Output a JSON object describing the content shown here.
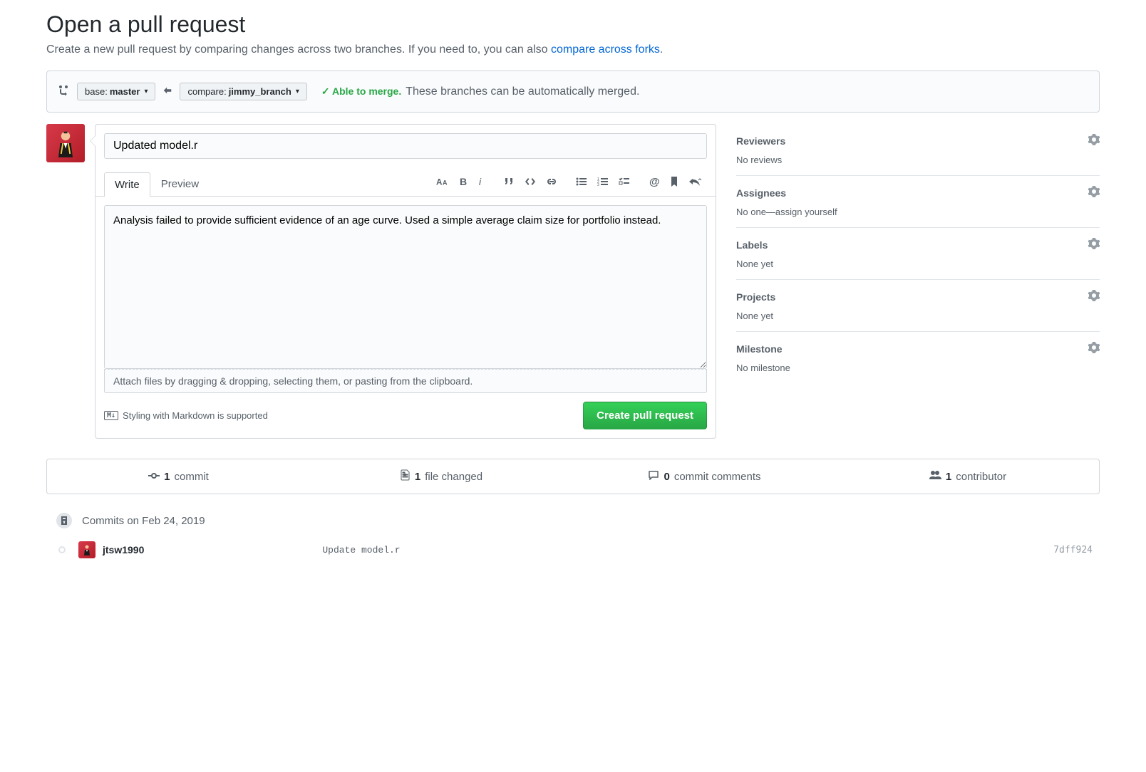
{
  "heading": "Open a pull request",
  "subheading_prefix": "Create a new pull request by comparing changes across two branches. If you need to, you can also ",
  "subheading_link": "compare across forks",
  "subheading_suffix": ".",
  "compare": {
    "base_label": "base: ",
    "base_value": "master",
    "compare_label": "compare: ",
    "compare_value": "jimmy_branch"
  },
  "merge_status": {
    "able": "Able to merge.",
    "detail": "These branches can be automatically merged."
  },
  "form": {
    "title_value": "Updated model.r",
    "tabs": {
      "write": "Write",
      "preview": "Preview"
    },
    "body_value": "Analysis failed to provide sufficient evidence of an age curve. Used a simple average claim size for portfolio instead.",
    "attach_hint": "Attach files by dragging & dropping, selecting them, or pasting from the clipboard.",
    "md_badge": "M↓",
    "md_hint": "Styling with Markdown is supported",
    "submit": "Create pull request"
  },
  "sidebar": {
    "reviewers": {
      "title": "Reviewers",
      "value": "No reviews"
    },
    "assignees": {
      "title": "Assignees",
      "value_prefix": "No one—",
      "value_link": "assign yourself"
    },
    "labels": {
      "title": "Labels",
      "value": "None yet"
    },
    "projects": {
      "title": "Projects",
      "value": "None yet"
    },
    "milestone": {
      "title": "Milestone",
      "value": "No milestone"
    }
  },
  "stats": {
    "commits": {
      "num": "1",
      "label": "commit"
    },
    "files": {
      "num": "1",
      "label": "file changed"
    },
    "comments": {
      "num": "0",
      "label": "commit comments"
    },
    "contributors": {
      "num": "1",
      "label": "contributor"
    }
  },
  "timeline": {
    "header": "Commits on Feb 24, 2019",
    "commit": {
      "author": "jtsw1990",
      "message": "Update model.r",
      "sha": "7dff924"
    }
  }
}
